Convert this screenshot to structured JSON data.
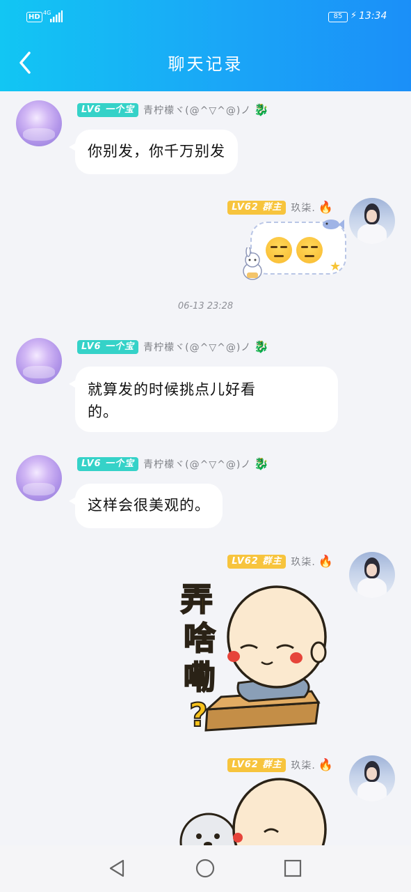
{
  "status_bar": {
    "hd": "HD",
    "network": "4G",
    "battery": "85",
    "time": "13:34"
  },
  "header": {
    "title": "聊天记录"
  },
  "messages": [
    {
      "badge": "LV6 一个宝",
      "sender": "青柠檬ヾ(@^▽^@)ノ",
      "text": "你别发，你千万别发"
    },
    {
      "badge": "LV62 群主",
      "sender": "玖柒."
    },
    {
      "badge": "LV6 一个宝",
      "sender": "青柠檬ヾ(@^▽^@)ノ",
      "text_line1": "就算发的时候挑点儿好看",
      "text_line2": "的。"
    },
    {
      "badge": "LV6 一个宝",
      "sender": "青柠檬ヾ(@^▽^@)ノ",
      "text": "这样会很美观的。"
    },
    {
      "badge": "LV62 群主",
      "sender": "玖柒."
    },
    {
      "badge": "LV62 群主",
      "sender": "玖柒."
    }
  ],
  "timestamp": "06-13 23:28",
  "sticker": {
    "chars": [
      "弄",
      "啥",
      "嘞",
      "?"
    ]
  },
  "colors": {
    "header_start": "#12c6f3",
    "header_end": "#1b8ff8",
    "badge_teal": "#35d2c8",
    "badge_gold": "#f7c43d",
    "background": "#f3f4f8"
  },
  "icons": {
    "back": "chevron-left-icon",
    "nav_back": "triangle-back-icon",
    "nav_home": "circle-home-icon",
    "nav_recent": "square-recent-icon"
  }
}
